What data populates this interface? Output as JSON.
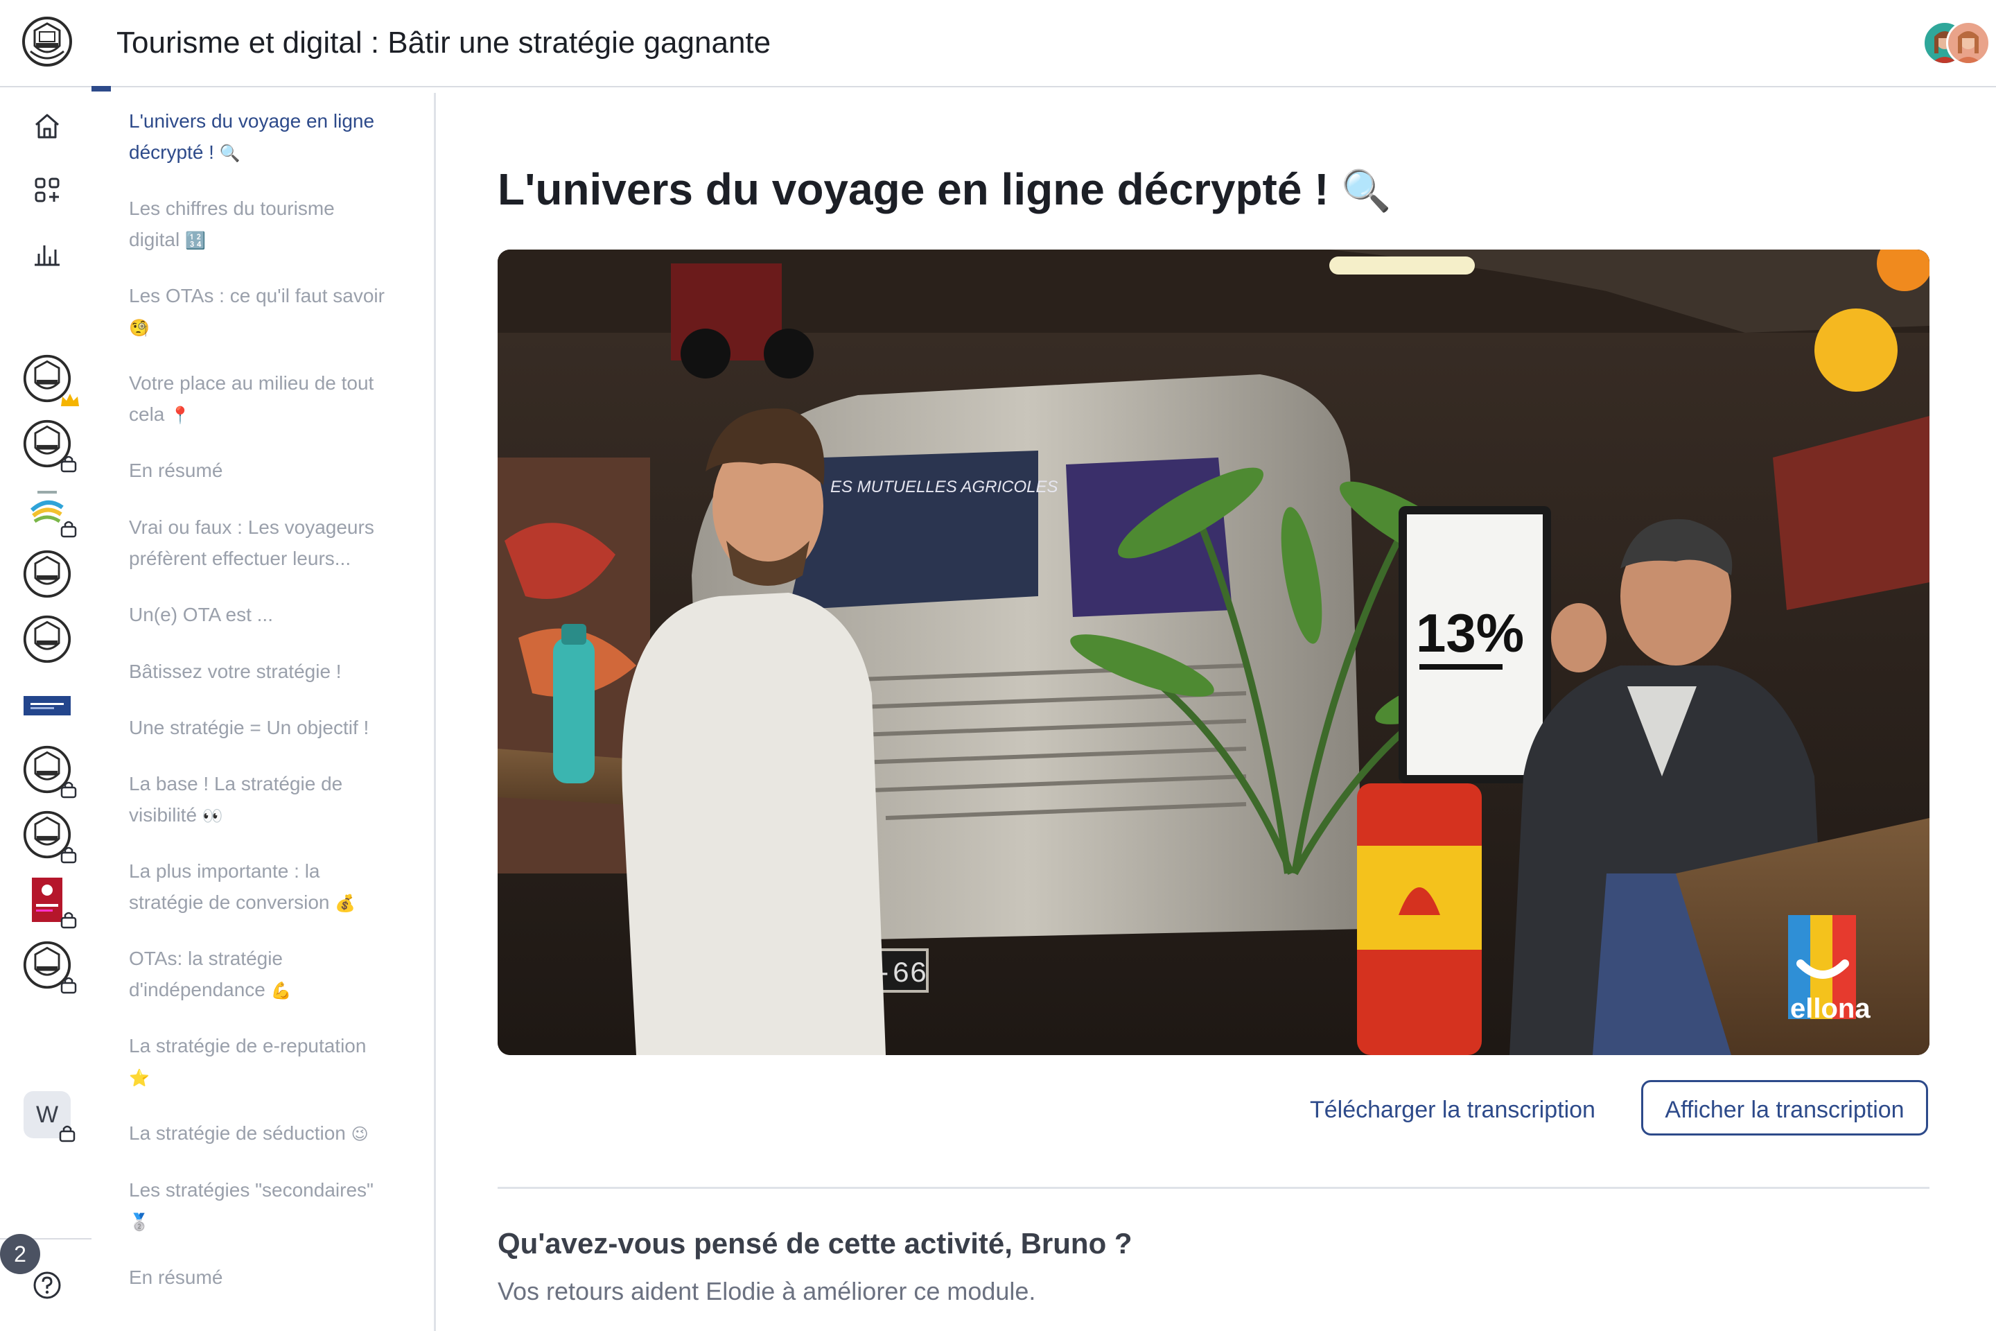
{
  "header": {
    "course_title": "Tourisme et digital : Bâtir une stratégie gagnante"
  },
  "rail": {
    "notification_count": "2",
    "workspace_letter": "W"
  },
  "lessons": [
    {
      "line1": "L'univers du voyage en ligne",
      "line2": "décrypté !",
      "emoji": "🔍",
      "active": true
    },
    {
      "line1": "Les chiffres du tourisme",
      "line2": "digital",
      "emoji": "🔢"
    },
    {
      "line1": "Les OTAs : ce qu'il faut savoir",
      "line2": "",
      "emoji": "🧐"
    },
    {
      "line1": "Votre place au milieu de tout",
      "line2": "cela",
      "emoji": "📍"
    },
    {
      "line1": "En résumé",
      "line2": "",
      "emoji": ""
    },
    {
      "line1": "Vrai ou faux : Les voyageurs",
      "line2": "préfèrent effectuer leurs...",
      "emoji": ""
    },
    {
      "line1": "Un(e) OTA est ...",
      "line2": "",
      "emoji": ""
    },
    {
      "line1": "Bâtissez votre stratégie !",
      "line2": "",
      "emoji": ""
    },
    {
      "line1": "Une stratégie = Un objectif !",
      "line2": "",
      "emoji": ""
    },
    {
      "line1": "La base ! La stratégie de",
      "line2": "visibilité",
      "emoji": "👀"
    },
    {
      "line1": "La plus importante : la",
      "line2": "stratégie de conversion",
      "emoji": "💰"
    },
    {
      "line1": "OTAs: la stratégie",
      "line2": "d'indépendance",
      "emoji": "💪"
    },
    {
      "line1": "La stratégie de e-reputation",
      "line2": "",
      "emoji": "⭐"
    },
    {
      "line1": "La stratégie de séduction",
      "line2": "",
      "emoji": "😉"
    },
    {
      "line1": "Les stratégies \"secondaires\"",
      "line2": "",
      "emoji": "🥈"
    },
    {
      "line1": "En résumé",
      "line2": "",
      "emoji": ""
    }
  ],
  "main": {
    "activity_title": "L'univers du voyage en ligne décrypté !",
    "activity_title_emoji": "🔍",
    "video": {
      "van_lettering": "ES MUTUELLES AGRICOLES",
      "screen_stat": "13%",
      "plate_text": "8-6EJ-66",
      "watermark": "ellona"
    },
    "download_transcript_label": "Télécharger la transcription",
    "show_transcript_label": "Afficher la transcription",
    "feedback_question": "Qu'avez-vous pensé de cette activité, Bruno ?",
    "feedback_subtitle": "Vos retours aident Elodie à améliorer ce module."
  },
  "colors": {
    "accent": "#2d4a8a",
    "muted_text": "#9aa0ab",
    "border": "#dfe2e8"
  }
}
